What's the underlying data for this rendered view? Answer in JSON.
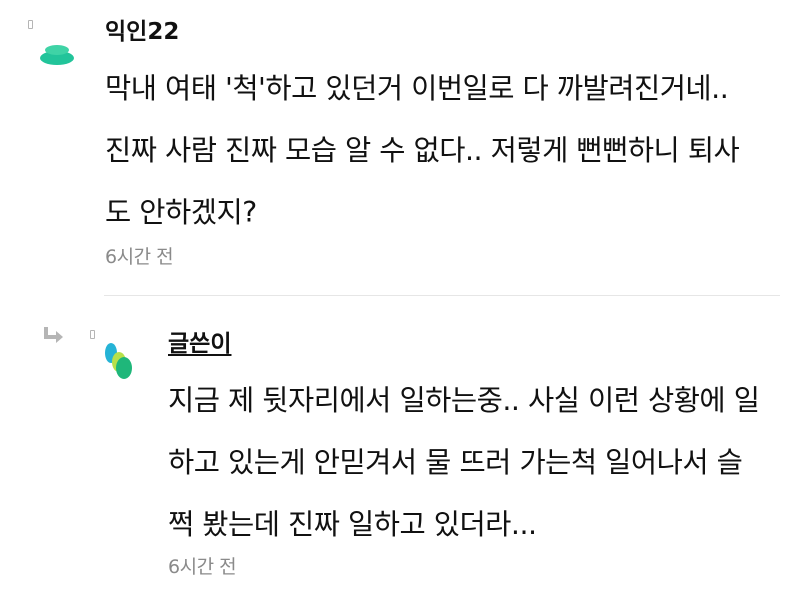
{
  "comment": {
    "author": "익인22",
    "lines": [
      "막내 여태 '척'하고 있던거 이번일로 다 까발려진거네..",
      "진짜 사람 진짜 모습 알 수 없다.. 저렇게 뻔뻔하니 퇴사",
      "도 안하겠지?"
    ],
    "time": "6시간 전",
    "avatar_color": "#22c49a"
  },
  "reply": {
    "author": "글쓴이",
    "lines": [
      "지금 제 뒷자리에서 일하는중.. 사실 이런 상황에 일",
      "하고 있는게 안믿겨서 물 뜨러 가는척 일어나서 슬",
      "쩍 봤는데 진짜 일하고 있더라..."
    ],
    "time": "6시간 전",
    "avatar_colors": [
      "#25b3d6",
      "#b7e04a",
      "#1fb77a"
    ]
  }
}
